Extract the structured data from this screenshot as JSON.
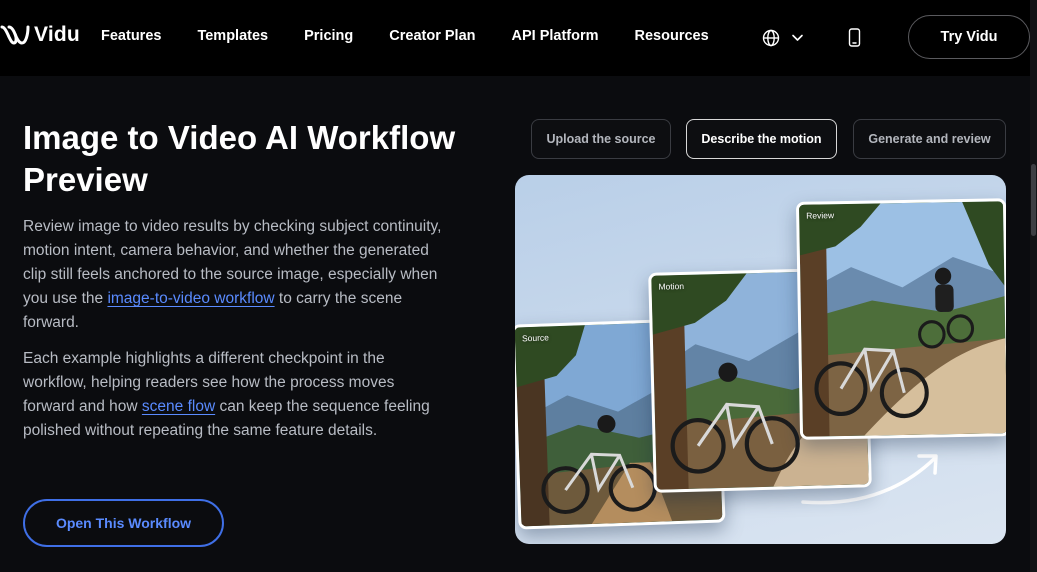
{
  "brand": {
    "name": "Vidu"
  },
  "nav": {
    "items": [
      {
        "label": "Features"
      },
      {
        "label": "Templates"
      },
      {
        "label": "Pricing"
      },
      {
        "label": "Creator Plan"
      },
      {
        "label": "API Platform"
      },
      {
        "label": "Resources"
      }
    ],
    "cta_label": "Try Vidu"
  },
  "hero": {
    "title": "Image to Video AI Workflow Preview",
    "p1_before": "Review image to video results by checking subject continuity, motion intent, camera behavior, and whether the generated clip still feels anchored to the source image, especially when you use the ",
    "p1_link": "image-to-video workflow",
    "p1_after": " to carry the scene forward.",
    "p2_before": "Each example highlights a different checkpoint in the workflow, helping readers see how the process moves forward and how ",
    "p2_link": "scene flow",
    "p2_after": " can keep the sequence feeling polished without repeating the same feature details.",
    "button_label": "Open This Workflow"
  },
  "steps": [
    {
      "label": "Upload the source",
      "active": false
    },
    {
      "label": "Describe the motion",
      "active": true
    },
    {
      "label": "Generate and review",
      "active": false
    }
  ],
  "preview": {
    "cards": [
      {
        "label": "Source"
      },
      {
        "label": "Motion"
      },
      {
        "label": "Review"
      }
    ]
  },
  "colors": {
    "background": "#0b0c0f",
    "topbar": "#000000",
    "accent": "#5a8bff",
    "text_muted": "#b8bcc4"
  },
  "icons": {
    "logo": "vidu-logo-icon",
    "globe": "globe-icon",
    "chevron": "chevron-down-icon",
    "phone": "mobile-phone-icon",
    "arrow": "curved-arrow-icon"
  }
}
